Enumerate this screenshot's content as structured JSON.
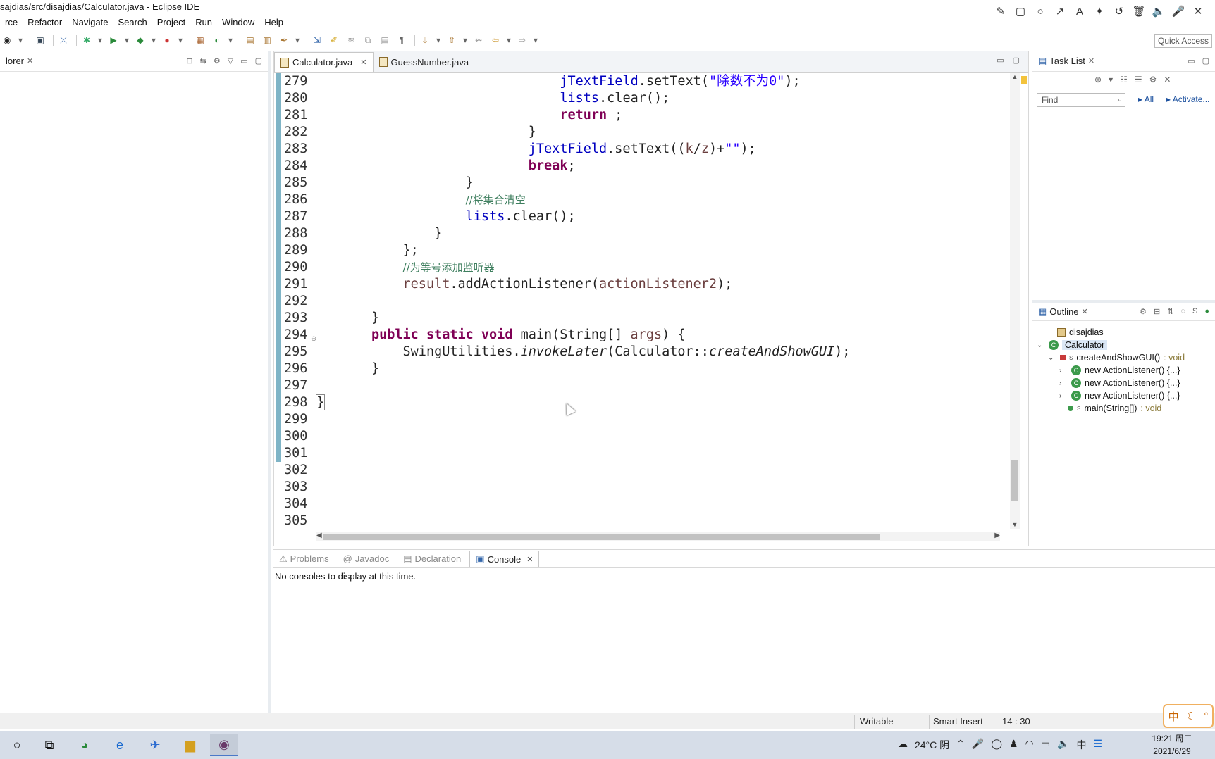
{
  "window": {
    "title": "sajdias/src/disajdias/Calculator.java - Eclipse IDE"
  },
  "menu": [
    "rce",
    "Refactor",
    "Navigate",
    "Search",
    "Project",
    "Run",
    "Window",
    "Help"
  ],
  "quick_access": {
    "placeholder": "Quick Access"
  },
  "left_panel": {
    "tab_label": "lorer"
  },
  "editor": {
    "tabs": [
      {
        "label": "Calculator.java",
        "active": true
      },
      {
        "label": "GuessNumber.java",
        "active": false
      }
    ],
    "lines": [
      {
        "num": "279",
        "indent": 31,
        "tokens": [
          [
            "fld",
            "jTextField"
          ],
          [
            "p",
            ".setText("
          ],
          [
            "str",
            "\"除数不为0\""
          ],
          [
            "p",
            ");"
          ]
        ]
      },
      {
        "num": "280",
        "indent": 31,
        "tokens": [
          [
            "fld",
            "lists"
          ],
          [
            "p",
            ".clear();"
          ]
        ]
      },
      {
        "num": "281",
        "indent": 31,
        "tokens": [
          [
            "kw",
            "return"
          ],
          [
            "p",
            " ;"
          ]
        ]
      },
      {
        "num": "282",
        "indent": 27,
        "tokens": [
          [
            "p",
            "}"
          ]
        ]
      },
      {
        "num": "283",
        "indent": 27,
        "tokens": [
          [
            "fld",
            "jTextField"
          ],
          [
            "p",
            ".setText(("
          ],
          [
            "var",
            "k"
          ],
          [
            "p",
            "/"
          ],
          [
            "var",
            "z"
          ],
          [
            "p",
            ")+"
          ],
          [
            "str",
            "\"\""
          ],
          [
            "p",
            ");"
          ]
        ]
      },
      {
        "num": "284",
        "indent": 27,
        "tokens": [
          [
            "kw",
            "break"
          ],
          [
            "p",
            ";"
          ]
        ]
      },
      {
        "num": "285",
        "indent": 19,
        "tokens": [
          [
            "p",
            "}"
          ]
        ]
      },
      {
        "num": "286",
        "indent": 19,
        "tokens": [
          [
            "cmt",
            "//将集合清空"
          ]
        ]
      },
      {
        "num": "287",
        "indent": 19,
        "tokens": [
          [
            "fld",
            "lists"
          ],
          [
            "p",
            ".clear();"
          ]
        ]
      },
      {
        "num": "288",
        "indent": 15,
        "tokens": [
          [
            "p",
            "}"
          ]
        ]
      },
      {
        "num": "289",
        "indent": 11,
        "tokens": [
          [
            "p",
            "};"
          ]
        ]
      },
      {
        "num": "290",
        "indent": 11,
        "tokens": [
          [
            "cmt",
            "//为等号添加监听器"
          ]
        ]
      },
      {
        "num": "291",
        "indent": 11,
        "tokens": [
          [
            "var",
            "result"
          ],
          [
            "p",
            ".addActionListener("
          ],
          [
            "var",
            "actionListener2"
          ],
          [
            "p",
            ");"
          ]
        ]
      },
      {
        "num": "292",
        "indent": 0,
        "tokens": []
      },
      {
        "num": "293",
        "indent": 7,
        "tokens": [
          [
            "p",
            "}"
          ]
        ]
      },
      {
        "num": "294",
        "indent": 7,
        "fold": true,
        "tokens": [
          [
            "kw",
            "public"
          ],
          [
            "p",
            " "
          ],
          [
            "kw",
            "static"
          ],
          [
            "p",
            " "
          ],
          [
            "kw",
            "void"
          ],
          [
            "p",
            " main(String[] "
          ],
          [
            "var",
            "args"
          ],
          [
            "p",
            ") {"
          ]
        ]
      },
      {
        "num": "295",
        "indent": 11,
        "tokens": [
          [
            "p",
            "SwingUtilities."
          ],
          [
            "it",
            "invokeLater"
          ],
          [
            "p",
            "(Calculator::"
          ],
          [
            "it",
            "createAndShowGUI"
          ],
          [
            "p",
            ");"
          ]
        ]
      },
      {
        "num": "296",
        "indent": 7,
        "tokens": [
          [
            "p",
            "}"
          ]
        ]
      },
      {
        "num": "297",
        "indent": 0,
        "tokens": []
      },
      {
        "num": "298",
        "indent": 0,
        "tokens": [
          [
            "brk",
            "}"
          ]
        ]
      },
      {
        "num": "299",
        "indent": 0,
        "tokens": []
      },
      {
        "num": "300",
        "indent": 0,
        "tokens": []
      },
      {
        "num": "301",
        "indent": 0,
        "tokens": []
      },
      {
        "num": "302",
        "indent": 0,
        "tokens": []
      },
      {
        "num": "303",
        "indent": 0,
        "tokens": []
      },
      {
        "num": "304",
        "indent": 0,
        "tokens": []
      },
      {
        "num": "305",
        "indent": 0,
        "tokens": []
      }
    ]
  },
  "task_list": {
    "tab_label": "Task List",
    "find_placeholder": "Find",
    "all_label": "All",
    "activate_label": "Activate..."
  },
  "outline": {
    "tab_label": "Outline",
    "package": "disajdias",
    "class": "Calculator",
    "methods": [
      {
        "label": "createAndShowGUI()",
        "ret": ": void"
      },
      {
        "label": "new ActionListener() {...}"
      },
      {
        "label": "new ActionListener() {...}"
      },
      {
        "label": "new ActionListener() {...}"
      },
      {
        "label": "main(String[])",
        "ret": ": void"
      }
    ]
  },
  "bottom_panel": {
    "tabs": [
      "Problems",
      "Javadoc",
      "Declaration",
      "Console"
    ],
    "active_tab": "Console",
    "message": "No consoles to display at this time."
  },
  "statusbar": {
    "writable": "Writable",
    "insert_mode": "Smart Insert",
    "position": "14 : 30"
  },
  "ime": {
    "label": "中"
  },
  "taskbar": {
    "weather": "24°C 阴",
    "ime_tray": "中",
    "time": "19:21 周二",
    "date": "2021/6/29"
  },
  "colors": {
    "keyword": "#7f0055",
    "field": "#0000c0",
    "string": "#2a00ff",
    "comment": "#3f7f5f",
    "change_bar": "#7fb4c6"
  }
}
